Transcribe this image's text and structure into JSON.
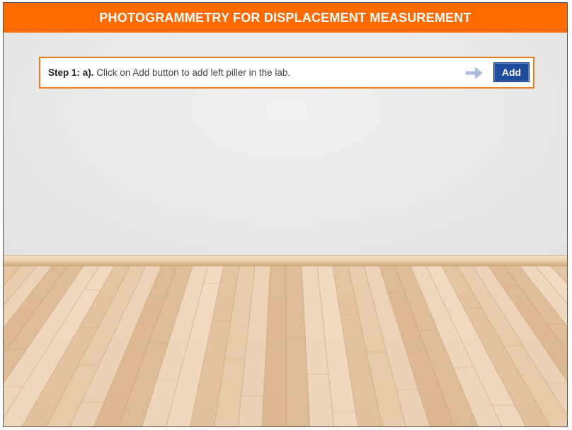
{
  "header": {
    "title": "PHOTOGRAMMETRY FOR DISPLACEMENT MEASUREMENT"
  },
  "instruction": {
    "step_label": "Step 1: a).",
    "text": " Click on Add button to add left piller in the lab."
  },
  "actions": {
    "add_label": "Add",
    "arrow_icon": "arrow-right-icon"
  },
  "colors": {
    "header_bg": "#ff6a00",
    "box_border": "#f07a1e",
    "button_bg": "#1f4c9a",
    "arrow": "#a9bcdc"
  }
}
